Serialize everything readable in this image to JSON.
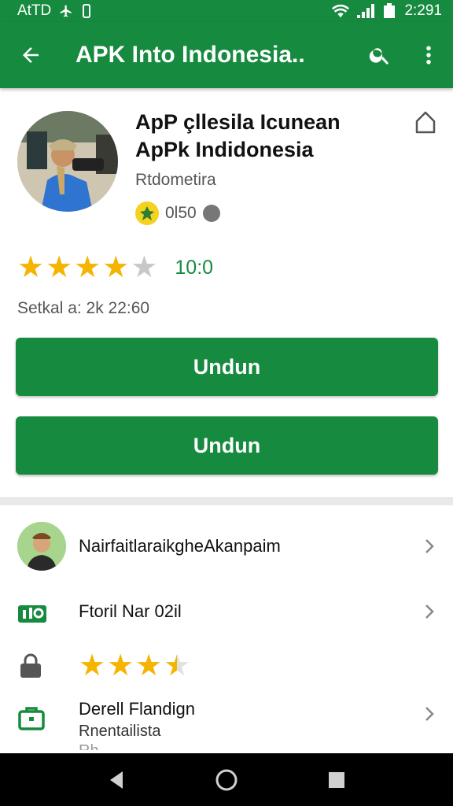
{
  "status_bar": {
    "carrier": "AtTD",
    "time": "2:291"
  },
  "app_bar": {
    "title": "APK Into Indonesia.."
  },
  "app": {
    "name_line1": "ApP çllesila Icunean",
    "name_line2": "ApPk Indidonesia",
    "developer": "Rtdometira",
    "badge_text": "0l50",
    "rating_stars": 4,
    "rating_value": "10:0",
    "meta": "Setkal a: 2k 22:60"
  },
  "buttons": {
    "primary": "Undun",
    "secondary": "Undun"
  },
  "list": {
    "row1": "NairfaitlaraikgheAkanpaim",
    "row2": "Ftoril  Nar 02il",
    "row3_stars": 3.5,
    "row4_title": "Derell Flandign",
    "row4_sub": "Rnentailista",
    "row4_sub2": "Rh..."
  },
  "colors": {
    "primary": "#168a3f",
    "star": "#f5b400",
    "star_empty": "#c8c8c8"
  },
  "icons": {
    "back": "arrow-back-icon",
    "search": "search-icon",
    "more": "more-vert-icon",
    "bookmark": "bookmark-icon",
    "chevron": "chevron-right-icon",
    "nav_back": "nav-back-icon",
    "nav_home": "nav-home-icon",
    "nav_recents": "nav-recents-icon"
  }
}
